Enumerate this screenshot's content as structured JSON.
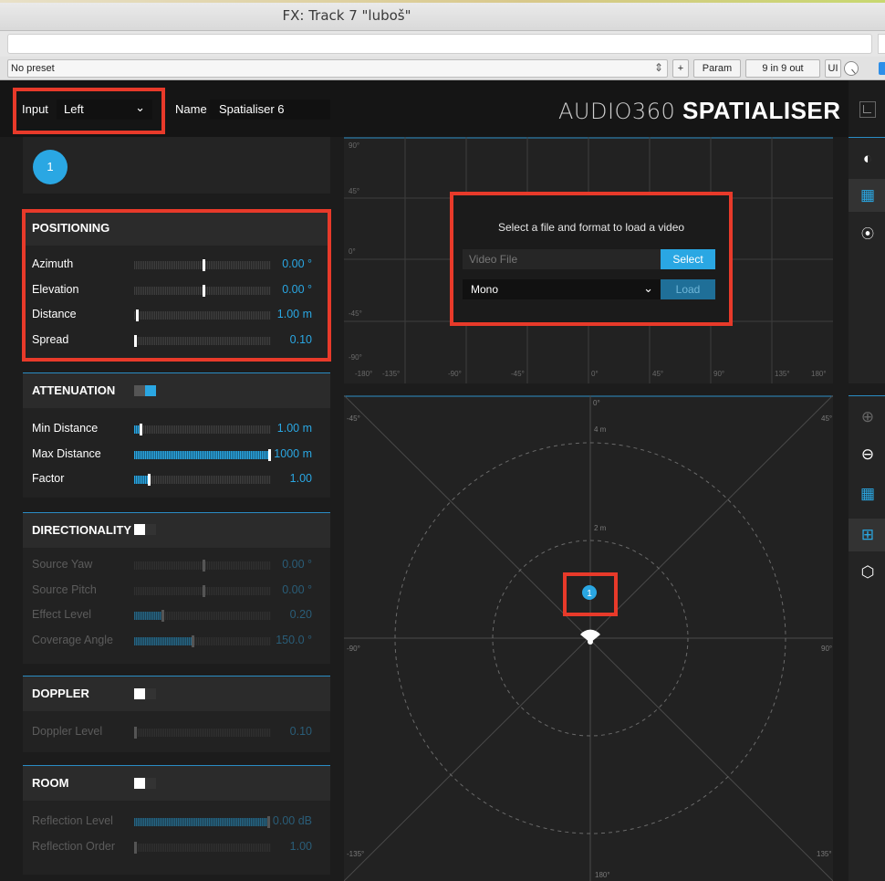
{
  "window": {
    "title": "FX: Track 7 \"luboš\""
  },
  "presetbar": {
    "preset": "No preset",
    "plus_label": "+",
    "param_label": "Param",
    "io_label": "9 in 9 out",
    "ui_label": "UI"
  },
  "header": {
    "input_label": "Input",
    "input_value": "Left",
    "name_label": "Name",
    "name_value": "Spatialiser 6",
    "logo_thin": "AUDIO360",
    "logo_bold": "SPATIALISER"
  },
  "source": {
    "number": "1"
  },
  "positioning": {
    "title": "POSITIONING",
    "rows": [
      {
        "label": "Azimuth",
        "value": "0.00 °",
        "level": 0.5
      },
      {
        "label": "Elevation",
        "value": "0.00 °",
        "level": 0.5
      },
      {
        "label": "Distance",
        "value": "1.00 m",
        "level": 0.01
      },
      {
        "label": "Spread",
        "value": "0.10",
        "level": 0.0
      }
    ]
  },
  "attenuation": {
    "title": "ATTENUATION",
    "enabled": true,
    "rows": [
      {
        "label": "Min Distance",
        "value": "1.00 m",
        "level": 0.04
      },
      {
        "label": "Max Distance",
        "value": "1000 m",
        "level": 1.0
      },
      {
        "label": "Factor",
        "value": "1.00",
        "level": 0.1
      }
    ]
  },
  "directionality": {
    "title": "DIRECTIONALITY",
    "enabled": false,
    "rows": [
      {
        "label": "Source Yaw",
        "value": "0.00 °",
        "level": 0.5
      },
      {
        "label": "Source Pitch",
        "value": "0.00 °",
        "level": 0.5
      },
      {
        "label": "Effect Level",
        "value": "0.20",
        "level": 0.2
      },
      {
        "label": "Coverage Angle",
        "value": "150.0 °",
        "level": 0.42
      }
    ]
  },
  "doppler": {
    "title": "DOPPLER",
    "enabled": false,
    "rows": [
      {
        "label": "Doppler Level",
        "value": "0.10",
        "level": 0.0
      }
    ]
  },
  "room": {
    "title": "ROOM",
    "enabled": false,
    "rows": [
      {
        "label": "Reflection Level",
        "value": "0.00 dB",
        "level": 0.97
      },
      {
        "label": "Reflection Order",
        "value": "1.00",
        "level": 0.0
      }
    ]
  },
  "video_dialog": {
    "prompt": "Select a file and format to load a video",
    "file_placeholder": "Video File",
    "select_label": "Select",
    "format_value": "Mono",
    "load_label": "Load"
  },
  "grid_view": {
    "y_labels": [
      "90°",
      "45°",
      "0°",
      "-45°",
      "-90°"
    ],
    "x_labels": [
      "-180°",
      "-135°",
      "-90°",
      "-45°",
      "0°",
      "45°",
      "90°",
      "135°",
      "180°"
    ]
  },
  "radar_view": {
    "ring_labels": [
      "4 m",
      "2 m"
    ],
    "top_label": "0°",
    "bottom_label": "180°",
    "left_label": "-90°",
    "right_label": "90°",
    "tl_label": "-45°",
    "tr_label": "45°",
    "bl_label": "-135°",
    "br_label": "135°",
    "source_number": "1"
  },
  "colors": {
    "accent": "#2aa7e3",
    "highlight": "#e83a2a",
    "background": "#1c1c1c"
  }
}
